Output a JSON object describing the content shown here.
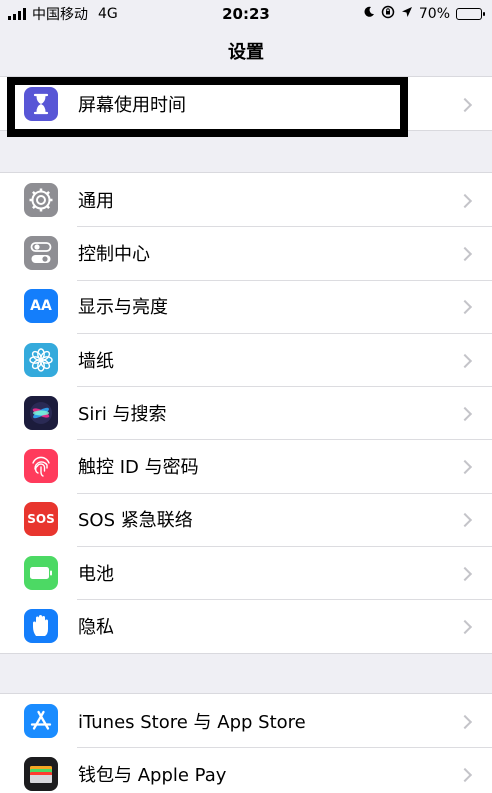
{
  "status_bar": {
    "carrier": "中国移动",
    "network": "4G",
    "time": "20:23",
    "battery_percent": "70%",
    "battery_level": 0.7
  },
  "nav": {
    "title": "设置"
  },
  "group1": [
    {
      "label": "屏幕使用时间",
      "icon": "hourglass-icon",
      "color": "#5856d6"
    }
  ],
  "group2": [
    {
      "label": "通用",
      "icon": "gear-icon",
      "color": "#8e8e93"
    },
    {
      "label": "控制中心",
      "icon": "toggles-icon",
      "color": "#8e8e93"
    },
    {
      "label": "显示与亮度",
      "icon": "text-size-icon",
      "color": "#147efb",
      "glyph": "AA"
    },
    {
      "label": "墙纸",
      "icon": "flower-icon",
      "color": "#34aadc"
    },
    {
      "label": "Siri 与搜索",
      "icon": "siri-icon",
      "color": "#1c1c3c"
    },
    {
      "label": "触控 ID 与密码",
      "icon": "fingerprint-icon",
      "color": "#ff3b5c"
    },
    {
      "label": "SOS 紧急联络",
      "icon": "sos-icon",
      "color": "#e8352e",
      "glyph": "SOS"
    },
    {
      "label": "电池",
      "icon": "battery-icon",
      "color": "#4cd964"
    },
    {
      "label": "隐私",
      "icon": "hand-icon",
      "color": "#147efb"
    }
  ],
  "group3": [
    {
      "label": "iTunes Store 与 App Store",
      "icon": "app-store-icon",
      "color": "#1a8cff"
    },
    {
      "label": "钱包与 Apple Pay",
      "icon": "wallet-icon",
      "color": "#1c1c1e"
    }
  ]
}
